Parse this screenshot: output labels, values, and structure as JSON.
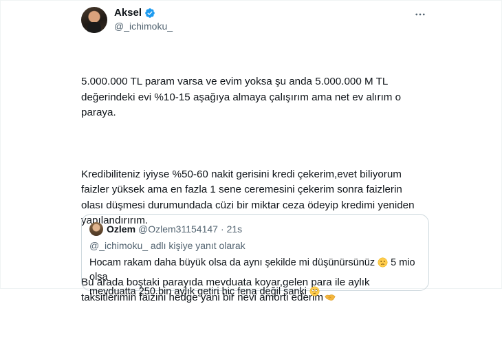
{
  "tweet": {
    "author_name": "Aksel",
    "author_handle": "@_ichimoku_",
    "verified": true,
    "paragraphs": [
      "5.000.000 TL param varsa ve evim yoksa şu anda 5.000.000 M TL\ndeğerindeki evi %10-15 aşağıya almaya çalışırım ama net ev alırım o\nparaya.",
      "Kredibiliteniz iyiyse %50-60 nakit gerisini kredi çekerim,evet biliyorum\nfaizler yüksek ama en fazla 1 sene ceremesini çekerim sonra faizlerin\nolası düşmesi durumundada cüzi bir miktar ceza ödeyip kredimi yeniden\nyapılandırırım.",
      "Bu arada boştaki parayıda mevduata koyar,gelen para ile aylık\ntaksitlerimin faizini hedge yani bir nevi amorti ederim"
    ],
    "more_icon": "more-horizontal-icon"
  },
  "quoted": {
    "author_name": "Ozlem",
    "author_handle": "@Ozlem31154147",
    "separator": "·",
    "time": "21s",
    "reply_context": "@_ichimoku_ adlı kişiye yanıt olarak",
    "line1": "Hocam rakam daha büyük olsa da aynı şekilde mi düşünürsünüz",
    "line1_tail": " 5 mio olsa",
    "line2": "mevduatta  250 bin aylık getiri hiç fena değil sanki "
  },
  "colors": {
    "verified_blue": "#1d9bf0",
    "secondary_text": "#536471",
    "border": "#cfd9de"
  }
}
